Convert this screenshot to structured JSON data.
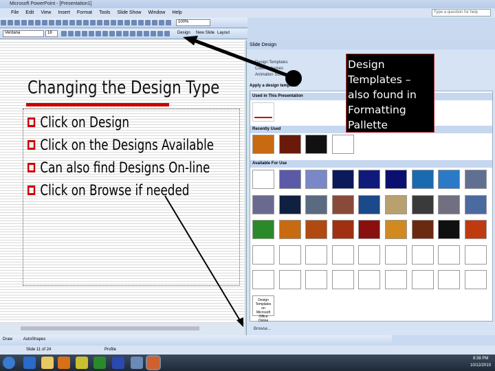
{
  "window": {
    "title": "Microsoft PowerPoint - [Presentation1]",
    "help_placeholder": "Type a question for help"
  },
  "menu": [
    "File",
    "Edit",
    "View",
    "Insert",
    "Format",
    "Tools",
    "Slide Show",
    "Window",
    "Help"
  ],
  "toolbar": {
    "zoom": "100%",
    "font": "Verdana",
    "size": "18",
    "design": "Design",
    "new_slide": "New Slide",
    "layout": "Layout"
  },
  "slide": {
    "title": "Changing the Design Type",
    "bullets": [
      "Click on Design",
      "Click on the Designs Available",
      "Can also find Designs On-line",
      "Click on Browse if needed"
    ]
  },
  "pane": {
    "title": "Slide Design",
    "links": [
      "Design Templates",
      "Color Schemes",
      "Animation Schemes"
    ],
    "apply_label": "Apply a design template:",
    "sections": [
      "Used in This Presentation",
      "Recently Used",
      "Available For Use"
    ],
    "browse": "Browse...",
    "online_thumb": "Design Templates on Microsoft Office Online"
  },
  "callout": "Design Templates – also found in Formatting Pallette",
  "drawbar": {
    "draw": "Draw",
    "autoshapes": "AutoShapes"
  },
  "status": {
    "slide": "Slide 11 of 24",
    "design": "Profile"
  },
  "taskbar": {
    "time": "8:38 PM",
    "date": "10/12/2010"
  },
  "templates": {
    "recent": [
      "#c86a10",
      "#6a1a0a",
      "#111111",
      "#ffffff"
    ],
    "available": [
      "#ffffff",
      "#5a5aa8",
      "#7a88c8",
      "#0a1a5a",
      "#101a7a",
      "#0a1070",
      "#1a6ab0",
      "#2a7ac8",
      "#607090",
      "#6a6a90",
      "#102040",
      "#5a6a80",
      "#8a4a3a",
      "#1a4a8a",
      "#b8a070",
      "#3a3a3a",
      "#707080",
      "#4a6aa0",
      "#2a8a2a",
      "#c86a10",
      "#b04a10",
      "#a03010",
      "#8a1010",
      "#d08a20",
      "#6a2a10",
      "#101010",
      "#c03a10",
      "#ffffff",
      "#ffffff",
      "#ffffff",
      "#ffffff",
      "#ffffff",
      "#ffffff",
      "#ffffff",
      "#ffffff",
      "#ffffff",
      "#ffffff",
      "#ffffff",
      "#ffffff",
      "#ffffff",
      "#ffffff",
      "#ffffff",
      "#ffffff",
      "#ffffff",
      "#ffffff"
    ]
  }
}
